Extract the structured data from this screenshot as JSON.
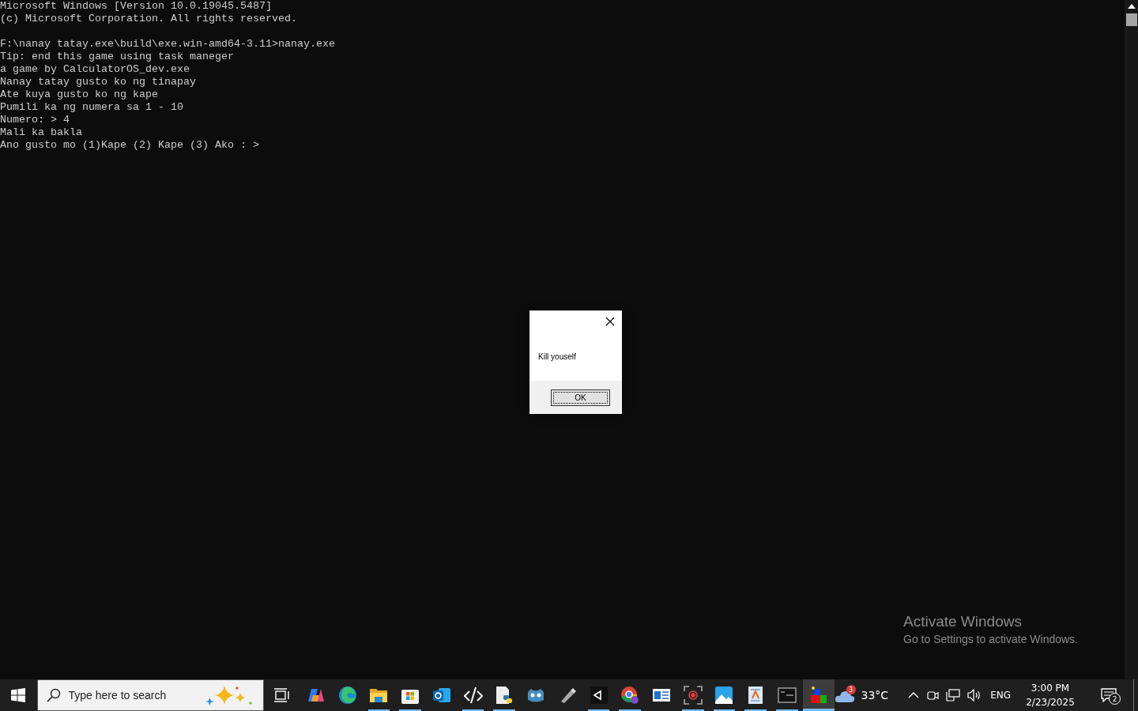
{
  "console": {
    "header": [
      "Microsoft Windows [Version 10.0.19045.5487]",
      "(c) Microsoft Corporation. All rights reserved."
    ],
    "lines": [
      "F:\\nanay tatay.exe\\build\\exe.win-amd64-3.11>nanay.exe",
      "Tip: end this game using task maneger",
      "a game by CalculatorOS_dev.exe",
      "Nanay tatay gusto ko ng tinapay",
      "Ate kuya gusto ko ng kape",
      "Pumili ka ng numera sa 1 - 10",
      "Numero: > 4",
      "Mali ka bakla",
      "Ano gusto mo (1)Kape (2) Kape (3) Ako : >"
    ]
  },
  "dialog": {
    "message": "Kill youself",
    "button": "OK"
  },
  "activation": {
    "title": "Activate Windows",
    "subtitle": "Go to Settings to activate Windows."
  },
  "taskbar": {
    "search": {
      "placeholder": "Type here to search"
    },
    "apps": [
      {
        "running": false,
        "selected": false
      },
      {
        "running": false,
        "selected": false
      },
      {
        "running": true,
        "selected": false
      },
      {
        "running": true,
        "selected": false
      },
      {
        "running": false,
        "selected": false
      },
      {
        "running": true,
        "selected": false
      },
      {
        "running": true,
        "selected": false
      },
      {
        "running": false,
        "selected": false
      },
      {
        "running": false,
        "selected": false
      },
      {
        "running": true,
        "selected": false
      },
      {
        "running": true,
        "selected": false
      },
      {
        "running": false,
        "selected": false
      },
      {
        "running": true,
        "selected": false
      },
      {
        "running": true,
        "selected": false
      },
      {
        "running": true,
        "selected": false
      },
      {
        "running": true,
        "selected": false
      },
      {
        "running": true,
        "selected": true
      }
    ],
    "weather": {
      "badge": "3",
      "temperature": "33°C"
    },
    "language": "ENG",
    "time": "3:00 PM",
    "date": "2/23/2025",
    "notifications": "2"
  }
}
